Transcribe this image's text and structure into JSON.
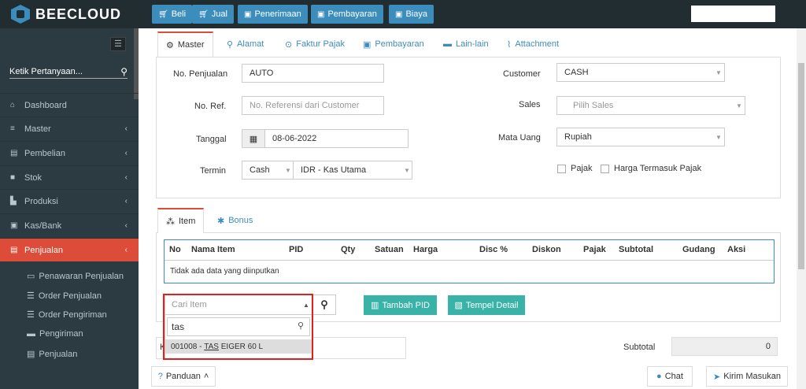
{
  "brand": {
    "name": "BEECLOUD"
  },
  "topbar": {
    "buttons": [
      {
        "icon": "cart-icon",
        "label": "Beli"
      },
      {
        "icon": "cart-icon",
        "label": "Jual"
      },
      {
        "icon": "money-icon",
        "label": "Penerimaan"
      },
      {
        "icon": "money-icon",
        "label": "Pembayaran"
      },
      {
        "icon": "money-icon",
        "label": "Biaya"
      }
    ]
  },
  "sidebar": {
    "search_placeholder": "Ketik Pertanyaan...",
    "items": [
      {
        "label": "Dashboard",
        "icon": "home-icon"
      },
      {
        "label": "Master",
        "icon": "database-icon"
      },
      {
        "label": "Pembelian",
        "icon": "cart-icon"
      },
      {
        "label": "Stok",
        "icon": "box-icon"
      },
      {
        "label": "Produksi",
        "icon": "industry-icon"
      },
      {
        "label": "Kas/Bank",
        "icon": "money-icon"
      },
      {
        "label": "Penjualan",
        "icon": "cart-icon",
        "active": true
      }
    ],
    "subitems": [
      "Penawaran Penjualan",
      "Order Penjualan",
      "Order Pengiriman",
      "Pengiriman",
      "Penjualan"
    ]
  },
  "tabs": [
    "Master",
    "Alamat",
    "Faktur Pajak",
    "Pembayaran",
    "Lain-lain",
    "Attachment"
  ],
  "form": {
    "no_penjualan_label": "No. Penjualan",
    "no_penjualan_value": "AUTO",
    "no_ref_label": "No. Ref.",
    "no_ref_placeholder": "No. Referensi dari Customer",
    "tanggal_label": "Tanggal",
    "tanggal_value": "08-06-2022",
    "termin_label": "Termin",
    "termin_value": "Cash",
    "kas_value": "IDR - Kas Utama",
    "customer_label": "Customer",
    "customer_value": "CASH",
    "sales_label": "Sales",
    "sales_placeholder": "Pilih Sales",
    "mata_uang_label": "Mata Uang",
    "mata_uang_value": "Rupiah",
    "pajak_label": "Pajak",
    "harga_pajak_label": "Harga Termasuk Pajak"
  },
  "item_tabs": [
    "Item",
    "Bonus"
  ],
  "table": {
    "headers": [
      "No",
      "Nama Item",
      "PID",
      "Qty",
      "Satuan",
      "Harga",
      "Disc %",
      "Diskon",
      "Pajak",
      "Subtotal",
      "Gudang",
      "Aksi"
    ],
    "empty_text": "Tidak ada data yang diinputkan"
  },
  "item_search": {
    "placeholder": "Cari Item",
    "query": "tas",
    "result_code": "001008",
    "result_sep": " - ",
    "result_hl": "TAS",
    "result_rest": " EIGER 60 L"
  },
  "buttons": {
    "tambah_pid": "Tambah PID",
    "tempel_detail": "Tempel Detail"
  },
  "summary": {
    "partial_label": "K",
    "subtotal_label": "Subtotal",
    "subtotal_value": "0"
  },
  "footer": {
    "panduan": "Panduan",
    "chat": "Chat",
    "kirim": "Kirim Masukan"
  }
}
